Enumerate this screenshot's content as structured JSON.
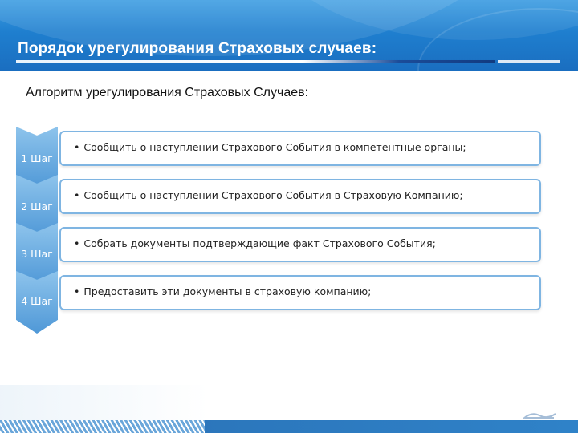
{
  "slide": {
    "title": "Порядок урегулирования Страховых случаев:",
    "subtitle": "Алгоритм урегулирования Страховых Случаев:",
    "steps": [
      {
        "label": "1 Шаг",
        "text": "Сообщить о наступлении Страхового События в компетентные органы;"
      },
      {
        "label": "2 Шаг",
        "text": "Сообщить о наступлении Страхового События в Страховую Компанию;"
      },
      {
        "label": "3 Шаг",
        "text": "Собрать документы подтверждающие факт Страхового События;"
      },
      {
        "label": "4 Шаг",
        "text": "Предоставить эти документы в  страховую компанию;"
      }
    ],
    "bullet": "•"
  },
  "colors": {
    "header_blue": "#1f7fcf",
    "chevron_blue": "#4f98d7",
    "box_border": "#7fb5e2"
  }
}
